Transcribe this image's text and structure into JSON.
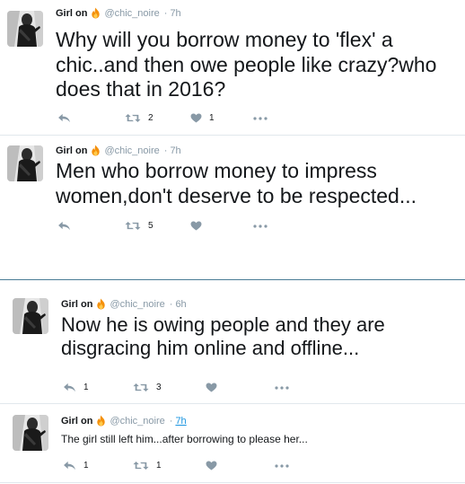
{
  "tweets": [
    {
      "name": "Girl on",
      "handle": "@chic_noire",
      "sep": "·",
      "time": "7h",
      "text": "Why will you borrow money to 'flex' a chic..and then owe people like crazy?who does that in 2016?",
      "reply_count": "",
      "retweet_count": "2",
      "like_count": "1"
    },
    {
      "name": "Girl on",
      "handle": "@chic_noire",
      "sep": "·",
      "time": "7h",
      "text": "Men who borrow money to impress women,don't deserve to be respected...",
      "reply_count": "",
      "retweet_count": "5",
      "like_count": ""
    },
    {
      "name": "Girl on",
      "handle": "@chic_noire",
      "sep": "·",
      "time": "6h",
      "text": "Now he is owing people and they are disgracing him online and offline...",
      "reply_count": "1",
      "retweet_count": "3",
      "like_count": ""
    },
    {
      "name": "Girl on",
      "handle": "@chic_noire",
      "sep": "·",
      "time": "7h",
      "text": "The girl still left him...after borrowing to please her...",
      "reply_count": "1",
      "retweet_count": "1",
      "like_count": ""
    }
  ],
  "colors": {
    "text": "#14171a",
    "muted": "#8899a6",
    "link": "#1b95e0",
    "divider": "#e1e8ed",
    "section_line": "#4a7c96"
  },
  "icons": [
    "avatar-photo",
    "fire-emoji",
    "reply-icon",
    "retweet-icon",
    "heart-icon",
    "more-icon"
  ]
}
